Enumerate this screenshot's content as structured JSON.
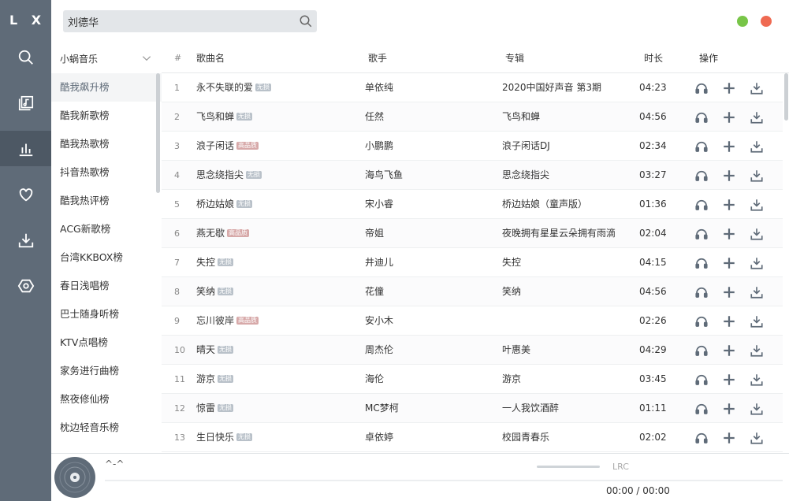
{
  "app": {
    "logo": "L X"
  },
  "nav": {
    "items": [
      "search-icon",
      "music-library-icon",
      "charts-icon",
      "heart-icon",
      "download-icon",
      "settings-icon"
    ],
    "active_index": 2
  },
  "search": {
    "value": "刘德华",
    "placeholder": ""
  },
  "source": {
    "selected": "小蜗音乐"
  },
  "boards": [
    "酷我飙升榜",
    "酷我新歌榜",
    "酷我热歌榜",
    "抖音热歌榜",
    "酷我热评榜",
    "ACG新歌榜",
    "台湾KKBOX榜",
    "春日浅唱榜",
    "巴士随身听榜",
    "KTV点唱榜",
    "家务进行曲榜",
    "熬夜修仙榜",
    "枕边轻音乐榜"
  ],
  "boards_active": 0,
  "table": {
    "headers": {
      "num": "#",
      "name": "歌曲名",
      "singer": "歌手",
      "album": "专辑",
      "time": "时长",
      "ops": "操作"
    },
    "badges": {
      "lossless": "无损",
      "hq": "高品质"
    },
    "rows": [
      {
        "num": "1",
        "name": "永不失联的爱",
        "badge": "lossless",
        "singer": "单依纯",
        "album": "2020中国好声音 第3期",
        "time": "04:23"
      },
      {
        "num": "2",
        "name": "飞鸟和蝉",
        "badge": "lossless",
        "singer": "任然",
        "album": "飞鸟和蝉",
        "time": "04:56"
      },
      {
        "num": "3",
        "name": "浪子闲话",
        "badge": "hq",
        "singer": "小鹏鹏",
        "album": "浪子闲话DJ",
        "time": "02:34"
      },
      {
        "num": "4",
        "name": "思念绕指尖",
        "badge": "lossless",
        "singer": "海鸟飞鱼",
        "album": "思念绕指尖",
        "time": "03:27"
      },
      {
        "num": "5",
        "name": "桥边姑娘",
        "badge": "lossless",
        "singer": "宋小睿",
        "album": "桥边姑娘（童声版）",
        "time": "01:36"
      },
      {
        "num": "6",
        "name": "燕无歇",
        "badge": "hq",
        "singer": "帝姐",
        "album": "夜晚拥有星星云朵拥有雨滴",
        "time": "02:04"
      },
      {
        "num": "7",
        "name": "失控",
        "badge": "lossless",
        "singer": "井迪儿",
        "album": "失控",
        "time": "04:15"
      },
      {
        "num": "8",
        "name": "笑纳",
        "badge": "lossless",
        "singer": "花僮",
        "album": "笑纳",
        "time": "04:56"
      },
      {
        "num": "9",
        "name": "忘川彼岸",
        "badge": "hq",
        "singer": "安小木",
        "album": "",
        "time": "02:26"
      },
      {
        "num": "10",
        "name": "晴天",
        "badge": "lossless",
        "singer": "周杰伦",
        "album": "叶惠美",
        "time": "04:29"
      },
      {
        "num": "11",
        "name": "游京",
        "badge": "lossless",
        "singer": "海伦",
        "album": "游京",
        "time": "03:45"
      },
      {
        "num": "12",
        "name": "惊雷",
        "badge": "lossless",
        "singer": "MC梦柯",
        "album": "一人我饮酒醉",
        "time": "01:11"
      },
      {
        "num": "13",
        "name": "生日快乐",
        "badge": "lossless",
        "singer": "卓依婷",
        "album": "校园青春乐",
        "time": "02:02"
      }
    ]
  },
  "player": {
    "track": "^-^",
    "lrc": "LRC",
    "time": "00:00 / 00:00",
    "progress": 0
  },
  "colors": {
    "nav_bg": "#5f6b78",
    "nav_active": "#4d5864",
    "accent_green": "#78c548",
    "accent_red": "#ef6a52"
  }
}
